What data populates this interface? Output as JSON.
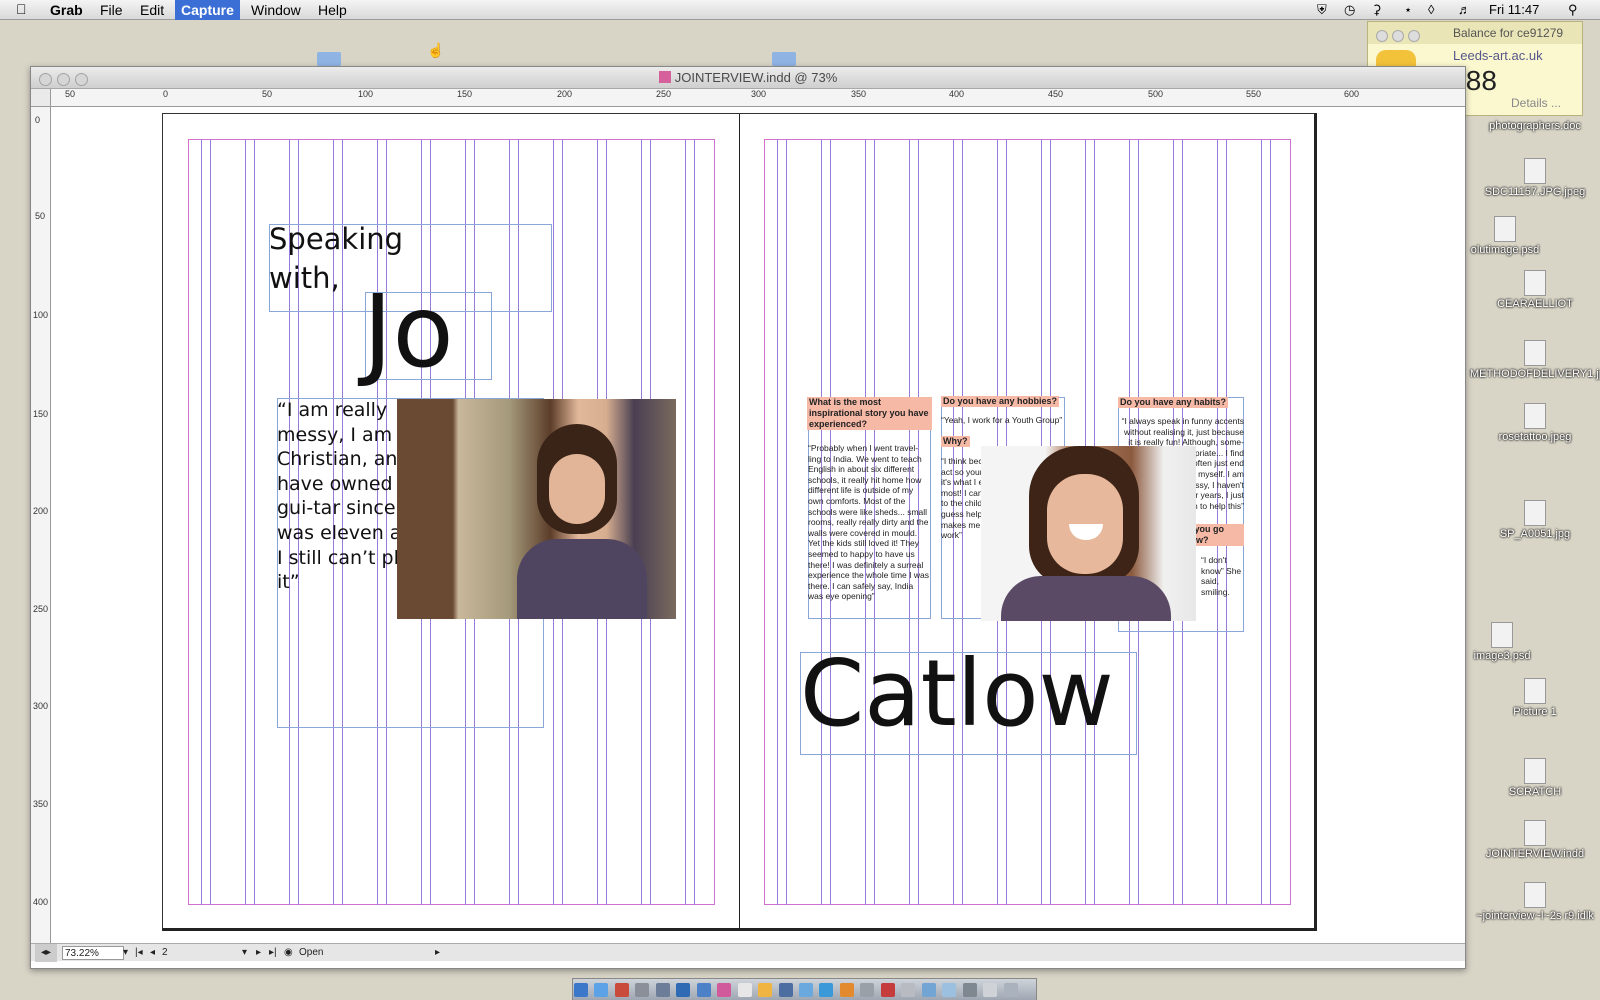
{
  "menubar": {
    "app_name": "Grab",
    "menus": [
      "File",
      "Edit",
      "Capture",
      "Window",
      "Help"
    ],
    "active_menu": "Capture",
    "clock": "Fri 11:47"
  },
  "widget": {
    "title": "Balance for ce91279",
    "subtitle": "Leeds-art.ac.uk",
    "amount": ".88",
    "details": "Details ..."
  },
  "desktop_icons": [
    "photographers.doc",
    "SDC11157.JPG.jpeg",
    "olutimage.psd",
    "CEARAELLIOT",
    "METHODOFDELIVERY1.jpg",
    "rosetattoo.jpeg",
    "SP_A0051.jpg",
    "image3.psd",
    "Picture 1",
    "SCRATCH",
    "JOINTERVIEW.indd",
    "~jointerview~l~2s r9.idlk"
  ],
  "document": {
    "title": "JOINTERVIEW.indd @ 73%",
    "ruler_h": [
      "50",
      "0",
      "50",
      "100",
      "150",
      "200",
      "250",
      "300",
      "350",
      "400",
      "450",
      "500",
      "550",
      "600"
    ],
    "ruler_v": [
      "0",
      "50",
      "100",
      "150",
      "200",
      "250",
      "300",
      "350",
      "400"
    ]
  },
  "left_page": {
    "speaking": "Speaking with,",
    "first_name": "Jo",
    "quote": "“I am really messy, I am a Christian, and, I have owned a gui-tar since I was eleven and I still can’t play it”"
  },
  "right_page": {
    "surname": "Catlow",
    "q1_head": "What is the most inspirational story you have experienced?",
    "q1_text": "“Probably when I went travel-ling to India. We went to teach English in about six different schools, it really hit home how different life is outside of my own comforts. Most of the schools were like sheds... small rooms, really really dirty and the walls were covered in mould. Yet the kids still loved it! They seemed to happy to have us there! I was definitely a surreal experience the whole time I was there. I can safely say, India was eye opening”",
    "q2_head": "Do you have any hobbies?",
    "q2_text": "“Yeah, I work for a Youth Group”",
    "q3_head": "Why?",
    "q3_text": "“I think because I can act so young because it's what I enjoy the most! I can really relate to the children and I guess helping others makes me love my work”",
    "q4_head": "Do you have any habits?",
    "q4_text": "“I always speak in funny accents without realising it, just because it is really fun! Although, some-times very inappropriate... I find myself silly and I often just end up laughing at myself. I am always really messy, I haven't had a tidy room for years, I just can't seem to help this”",
    "q5_head": "What will you go and do now?",
    "q5_text": "“I don't know” She said, smiling."
  },
  "statusbar": {
    "zoom": "73.22%",
    "page": "2",
    "status": "Open"
  }
}
